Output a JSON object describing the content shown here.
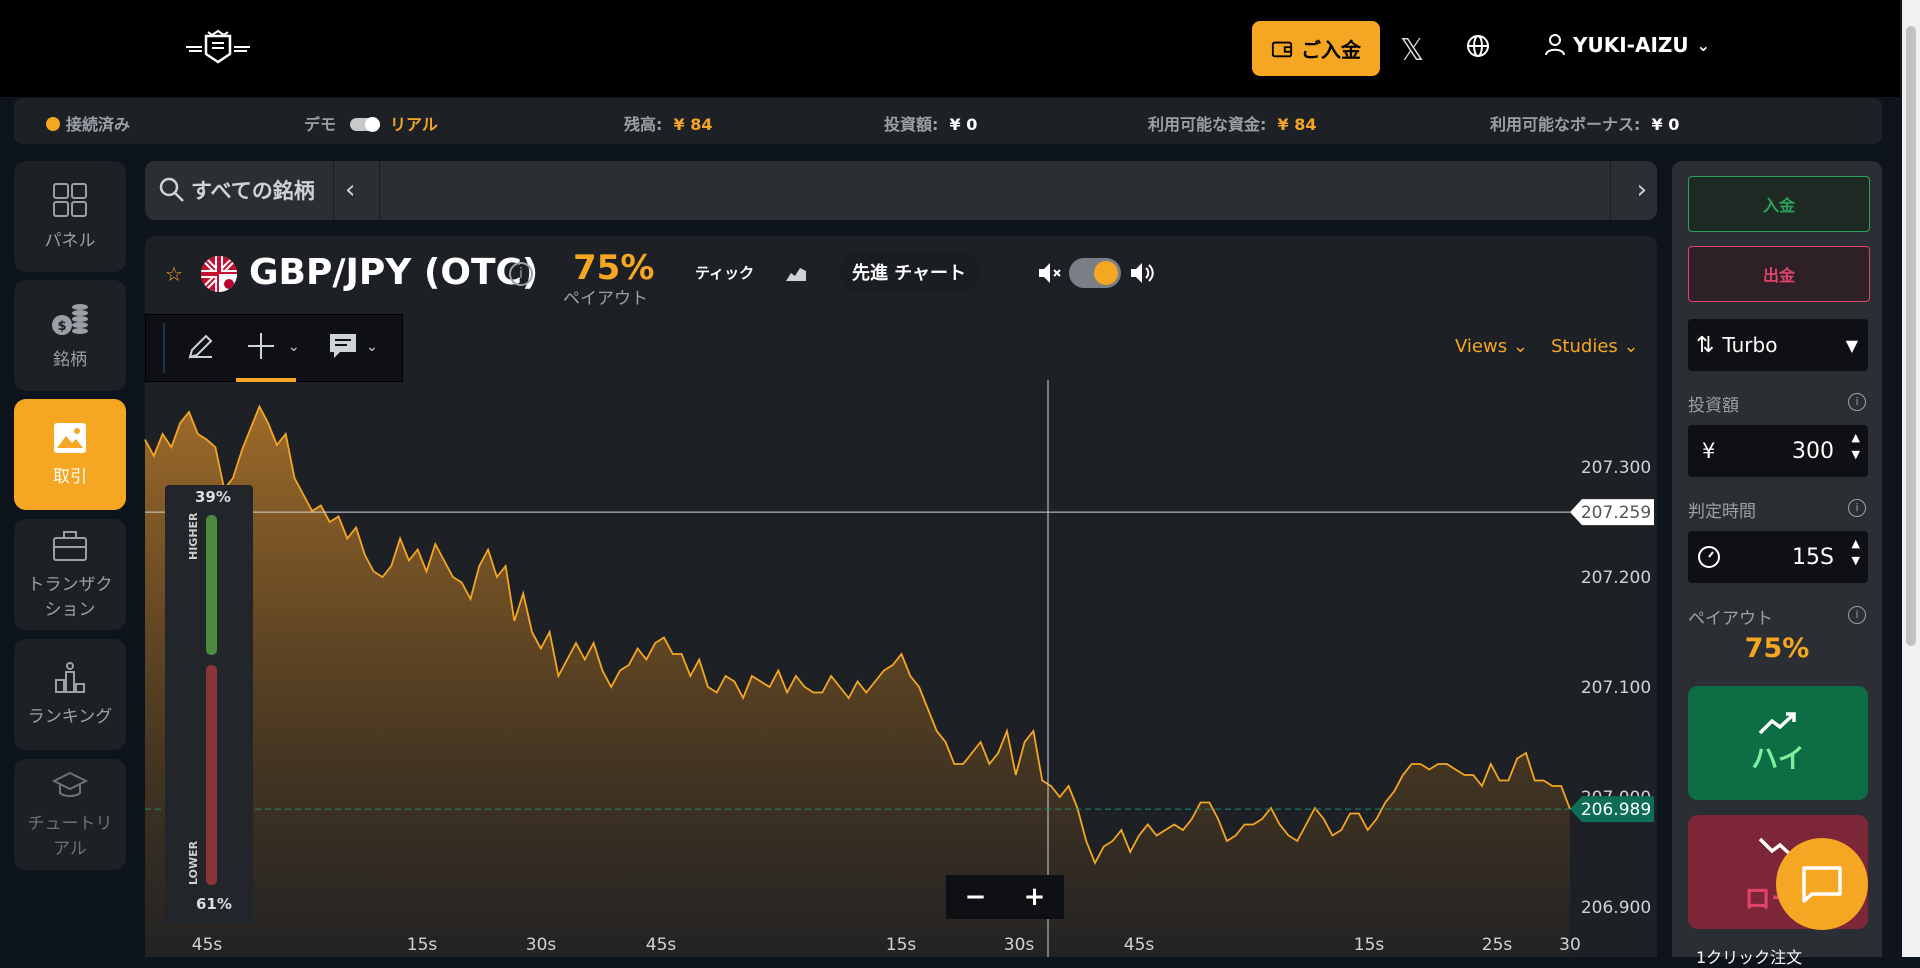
{
  "header": {
    "deposit_label": "ご入金",
    "username": "YUKI-AIZU"
  },
  "statusbar": {
    "connection": "接続済み",
    "demo_label": "デモ",
    "real_label": "リアル",
    "balance_label": "残高:",
    "balance_value": "¥ 84",
    "invested_label": "投資額:",
    "invested_value": "¥ 0",
    "available_label": "利用可能な資金:",
    "available_value": "¥ 84",
    "bonus_label": "利用可能なボーナス:",
    "bonus_value": "¥ 0"
  },
  "sidebar": {
    "items": [
      {
        "label": "パネル",
        "icon": "grid-icon"
      },
      {
        "label": "銘柄",
        "icon": "coins-icon"
      },
      {
        "label": "取引",
        "icon": "image-icon"
      },
      {
        "label": "トランザクション",
        "icon": "briefcase-icon"
      },
      {
        "label": "ランキング",
        "icon": "podium-icon"
      },
      {
        "label": "チュートリアル",
        "icon": "graduation-cap-icon"
      }
    ]
  },
  "search": {
    "label": "すべての銘柄"
  },
  "chart_header": {
    "symbol": "GBP/JPY (OTC)",
    "payout_pct": "75%",
    "payout_label": "ペイアウト",
    "tick_label": "ティック",
    "advanced_chart_label": "先進 チャート",
    "views_label": "Views",
    "studies_label": "Studies"
  },
  "sentiment": {
    "higher_pct": "39%",
    "lower_pct": "61%",
    "higher_label": "HIGHER",
    "lower_label": "LOWER"
  },
  "zoom": {
    "minus": "−",
    "plus": "+"
  },
  "chart_data": {
    "type": "area",
    "series": [
      {
        "values": [
          207.325,
          207.31,
          207.33,
          207.318,
          207.34,
          207.35,
          207.33,
          207.325,
          207.318,
          207.28,
          207.29,
          207.315,
          207.335,
          207.355,
          207.34,
          207.32,
          207.33,
          207.29,
          207.275,
          207.26,
          207.265,
          207.25,
          207.255,
          207.235,
          207.245,
          207.22,
          207.205,
          207.2,
          207.21,
          207.235,
          207.215,
          207.225,
          207.205,
          207.23,
          207.215,
          207.2,
          207.195,
          207.18,
          207.21,
          207.225,
          207.2,
          207.21,
          207.16,
          207.185,
          207.15,
          207.135,
          207.15,
          207.11,
          207.125,
          207.14,
          207.125,
          207.14,
          207.115,
          207.1,
          207.115,
          207.12,
          207.135,
          207.125,
          207.14,
          207.145,
          207.13,
          207.13,
          207.11,
          207.125,
          207.1,
          207.095,
          207.11,
          207.105,
          207.09,
          207.11,
          207.105,
          207.1,
          207.115,
          207.095,
          207.11,
          207.1,
          207.095,
          207.095,
          207.11,
          207.1,
          207.09,
          207.105,
          207.095,
          207.105,
          207.115,
          207.12,
          207.13,
          207.11,
          207.1,
          207.08,
          207.06,
          207.05,
          207.03,
          207.03,
          207.04,
          207.05,
          207.03,
          207.04,
          207.06,
          207.02,
          207.05,
          207.06,
          207.015,
          207.01,
          207.0,
          207.01,
          206.99,
          206.96,
          206.94,
          206.955,
          206.96,
          206.97,
          206.95,
          206.965,
          206.975,
          206.965,
          206.97,
          206.975,
          206.97,
          206.98,
          206.995,
          206.995,
          206.98,
          206.96,
          206.965,
          206.975,
          206.975,
          206.98,
          206.99,
          206.975,
          206.965,
          206.96,
          206.975,
          206.99,
          206.98,
          206.965,
          206.97,
          206.985,
          206.985,
          206.97,
          206.98,
          206.995,
          207.005,
          207.02,
          207.03,
          207.03,
          207.025,
          207.03,
          207.03,
          207.025,
          207.02,
          207.02,
          207.01,
          207.03,
          207.015,
          207.015,
          207.035,
          207.04,
          207.015,
          207.015,
          207.01,
          207.01,
          206.989
        ]
      }
    ],
    "price_labels": [
      "207.300",
      "207.200",
      "207.100",
      "207.000",
      "206.900"
    ],
    "current_price": "207.259",
    "last_price": "206.989",
    "x_tick_labels": [
      "45s",
      "15s",
      "30s",
      "45s",
      "15s",
      "30s",
      "45s",
      "15s",
      "25s",
      "30"
    ],
    "ylim": [
      206.9,
      207.36
    ]
  },
  "right_panel": {
    "deposit_label": "入金",
    "withdraw_label": "出金",
    "mode": "Turbo",
    "amount_label": "投資額",
    "currency": "¥",
    "amount_value": "300",
    "duration_label": "判定時間",
    "duration_value": "15S",
    "payout_label": "ペイアウト",
    "payout_value": "75%",
    "high_label": "ハイ",
    "low_label": "ロー",
    "oneclick_label": "1クリック注文"
  }
}
